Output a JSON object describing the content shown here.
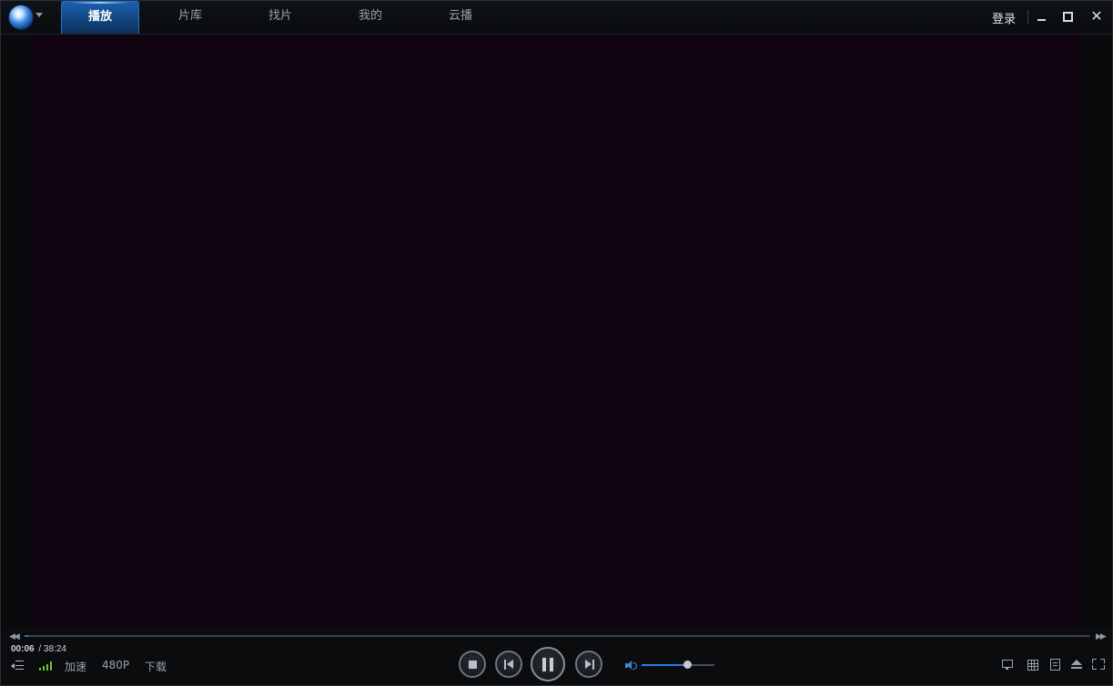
{
  "nav": {
    "tabs": [
      {
        "label": "播放",
        "active": true
      },
      {
        "label": "片库",
        "active": false
      },
      {
        "label": "找片",
        "active": false
      },
      {
        "label": "我的",
        "active": false
      },
      {
        "label": "云播",
        "active": false
      }
    ]
  },
  "window": {
    "login_label": "登录",
    "minimize_icon": "minimize-icon",
    "maximize_icon": "maximize-icon",
    "close_icon": "close-icon"
  },
  "playback": {
    "current_time": "00:06",
    "total_time": "/ 38:24",
    "progress_fraction": 0.003,
    "volume_fraction": 0.62
  },
  "bottom_bar": {
    "accelerate_label": "加速",
    "quality_label": "480P",
    "download_label": "下载"
  },
  "colors": {
    "accent": "#2a7be0",
    "video_background": "#110410",
    "signal_green": "#6cc23a"
  }
}
